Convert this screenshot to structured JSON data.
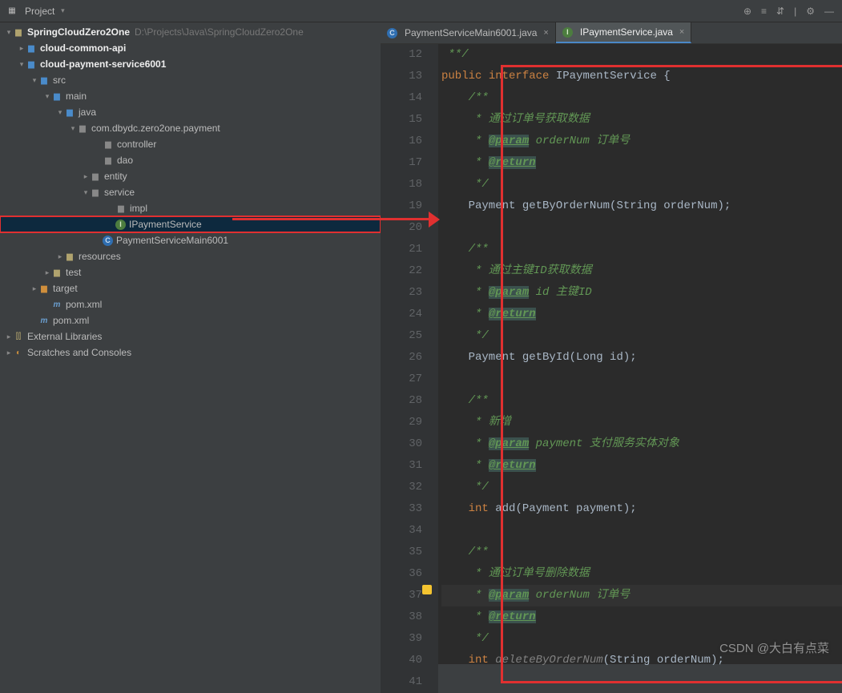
{
  "topbar": {
    "project_label": "Project"
  },
  "tree": {
    "root": "SpringCloudZero2One",
    "root_path": "D:\\Projects\\Java\\SpringCloudZero2One",
    "items": [
      "cloud-common-api",
      "cloud-payment-service6001",
      "src",
      "main",
      "java",
      "com.dbydc.zero2one.payment",
      "controller",
      "dao",
      "entity",
      "service",
      "impl",
      "IPaymentService",
      "PaymentServiceMain6001",
      "resources",
      "test",
      "target",
      "pom.xml",
      "pom.xml",
      "External Libraries",
      "Scratches and Consoles"
    ]
  },
  "tabs": {
    "t1": "PaymentServiceMain6001.java",
    "t2": "IPaymentService.java"
  },
  "code": {
    "l12": " **/",
    "l13_public": "public",
    "l13_interface": "interface",
    "l13_name": "IPaymentService",
    "l13_brace": " {",
    "l14": "    /**",
    "l15": "     * 通过订单号获取数据",
    "l16a": "     * ",
    "l16_tag": "@param",
    "l16b": " orderNum 订单号",
    "l17a": "     * ",
    "l17_tag": "@return",
    "l18": "     */",
    "l19_ret": "    Payment ",
    "l19_m": "getByOrderNum",
    "l19_p": "(String orderNum);",
    "l20": "",
    "l21": "    /**",
    "l22": "     * 通过主键ID获取数据",
    "l23a": "     * ",
    "l23_tag": "@param",
    "l23b": " id 主键ID",
    "l24a": "     * ",
    "l24_tag": "@return",
    "l25": "     */",
    "l26_ret": "    Payment ",
    "l26_m": "getById",
    "l26_p": "(Long id);",
    "l27": "",
    "l28": "    /**",
    "l29": "     * 新增",
    "l30a": "     * ",
    "l30_tag": "@param",
    "l30b": " payment 支付服务实体对象",
    "l31a": "     * ",
    "l31_tag": "@return",
    "l32": "     */",
    "l33_ret": "    int ",
    "l33_m": "add",
    "l33_p": "(Payment payment);",
    "l34": "",
    "l35": "    /**",
    "l36": "     * 通过订单号删除数据",
    "l37a": "     * ",
    "l37_tag": "@param",
    "l37b": " orderNum 订单号",
    "l38a": "     * ",
    "l38_tag": "@return",
    "l39": "     */",
    "l40_ret": "    int ",
    "l40_m": "deleteByOrderNum",
    "l40_p": "(String orderNum);",
    "l41": ""
  },
  "lines": [
    "12",
    "13",
    "14",
    "15",
    "16",
    "17",
    "18",
    "19",
    "20",
    "21",
    "22",
    "23",
    "24",
    "25",
    "26",
    "27",
    "28",
    "29",
    "30",
    "31",
    "32",
    "33",
    "34",
    "35",
    "36",
    "37",
    "38",
    "39",
    "40",
    "41"
  ],
  "watermark": "CSDN @大白有点菜"
}
